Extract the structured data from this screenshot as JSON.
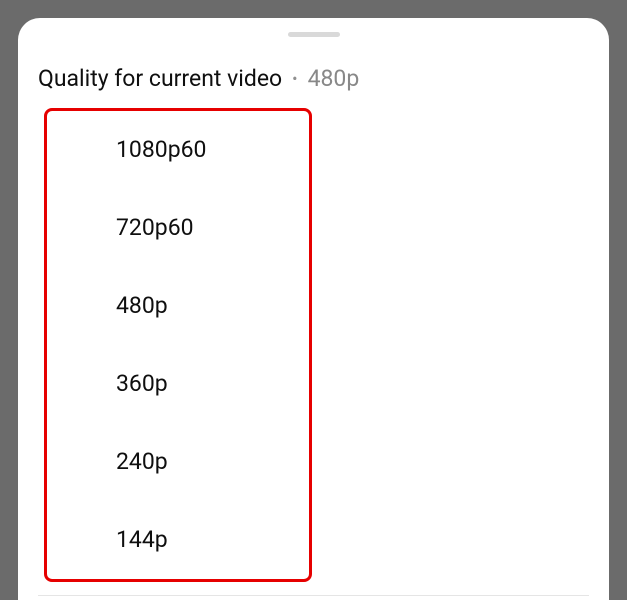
{
  "header": {
    "title": "Quality for current video",
    "separator": "•",
    "current": "480p"
  },
  "options": [
    {
      "label": "1080p60"
    },
    {
      "label": "720p60"
    },
    {
      "label": "480p"
    },
    {
      "label": "360p"
    },
    {
      "label": "240p"
    },
    {
      "label": "144p"
    }
  ]
}
